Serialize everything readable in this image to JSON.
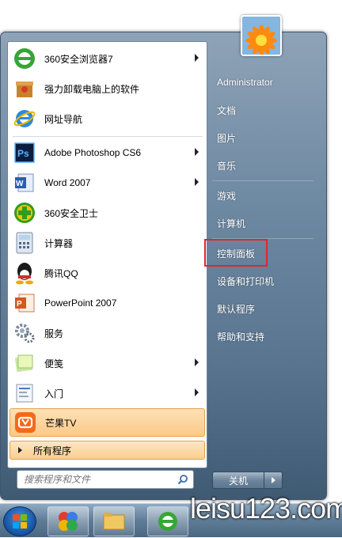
{
  "left_items": [
    {
      "label": "360安全浏览器7",
      "icon": "360-browser-icon",
      "has_arrow": true
    },
    {
      "label": "强力卸载电脑上的软件",
      "icon": "uninstall-icon",
      "has_arrow": false
    },
    {
      "label": "网址导航",
      "icon": "ie-icon",
      "has_arrow": false
    },
    {
      "label": "Adobe Photoshop CS6",
      "icon": "photoshop-icon",
      "has_arrow": true
    },
    {
      "label": "Word 2007",
      "icon": "word-icon",
      "has_arrow": true
    },
    {
      "label": "360安全卫士",
      "icon": "360-safe-icon",
      "has_arrow": false
    },
    {
      "label": "计算器",
      "icon": "calculator-icon",
      "has_arrow": false
    },
    {
      "label": "腾讯QQ",
      "icon": "qq-icon",
      "has_arrow": false
    },
    {
      "label": "PowerPoint 2007",
      "icon": "powerpoint-icon",
      "has_arrow": false
    },
    {
      "label": "服务",
      "icon": "services-icon",
      "has_arrow": false
    },
    {
      "label": "便笺",
      "icon": "sticky-notes-icon",
      "has_arrow": true
    },
    {
      "label": "入门",
      "icon": "getting-started-icon",
      "has_arrow": true
    },
    {
      "label": "芒果TV",
      "icon": "mango-tv-icon",
      "has_arrow": false
    }
  ],
  "all_programs": "所有程序",
  "search_placeholder": "搜索程序和文件",
  "right_items": [
    {
      "label": "Administrator"
    },
    {
      "label": "文档"
    },
    {
      "label": "图片"
    },
    {
      "label": "音乐"
    },
    {
      "label": "游戏"
    },
    {
      "label": "计算机"
    },
    {
      "label": "控制面板"
    },
    {
      "label": "设备和打印机"
    },
    {
      "label": "默认程序"
    },
    {
      "label": "帮助和支持"
    }
  ],
  "shutdown_label": "关机",
  "watermark": "leisu123.com",
  "colors": {
    "highlight_box": "#e0262b",
    "menu_hover": "#fcc987"
  }
}
